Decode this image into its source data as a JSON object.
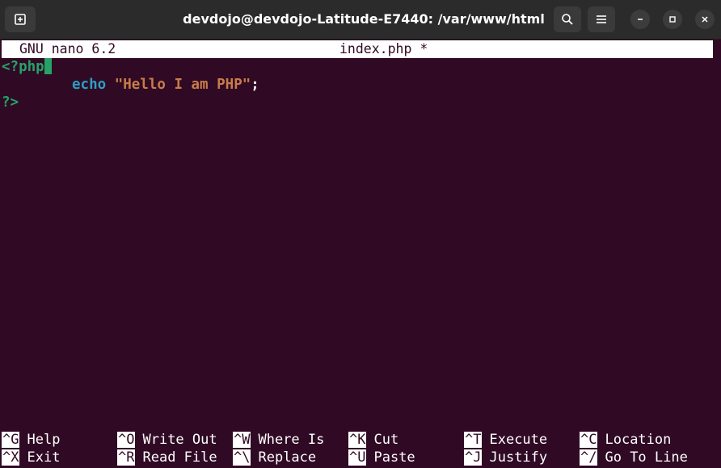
{
  "window": {
    "title": "devdojo@devdojo-Latitude-E7440: /var/www/html"
  },
  "nano": {
    "version": "GNU nano 6.2",
    "filename": "index.php *"
  },
  "editor": {
    "lines": [
      {
        "open_tag": "<?php"
      },
      {
        "keyword": "echo",
        "string": "\"Hello I am PHP\"",
        "end": ";"
      },
      {
        "close_tag": "?>"
      }
    ]
  },
  "shortcuts": [
    {
      "key": "^G",
      "label": "Help"
    },
    {
      "key": "^X",
      "label": "Exit"
    },
    {
      "key": "^O",
      "label": "Write Out"
    },
    {
      "key": "^R",
      "label": "Read File"
    },
    {
      "key": "^W",
      "label": "Where Is"
    },
    {
      "key": "^\\",
      "label": "Replace"
    },
    {
      "key": "^K",
      "label": "Cut"
    },
    {
      "key": "^U",
      "label": "Paste"
    },
    {
      "key": "^T",
      "label": "Execute"
    },
    {
      "key": "^J",
      "label": "Justify"
    },
    {
      "key": "^C",
      "label": "Location"
    },
    {
      "key": "^/",
      "label": "Go To Line"
    }
  ],
  "icons": {
    "new_tab": "new-tab-icon",
    "search": "search-icon",
    "menu": "hamburger-menu-icon",
    "minimize": "minimize-icon",
    "maximize": "maximize-icon",
    "close": "close-icon"
  },
  "colors": {
    "terminal_bg": "#300a24",
    "php_tag": "#26a269",
    "keyword": "#2a9fc4",
    "string": "#c77c49"
  }
}
